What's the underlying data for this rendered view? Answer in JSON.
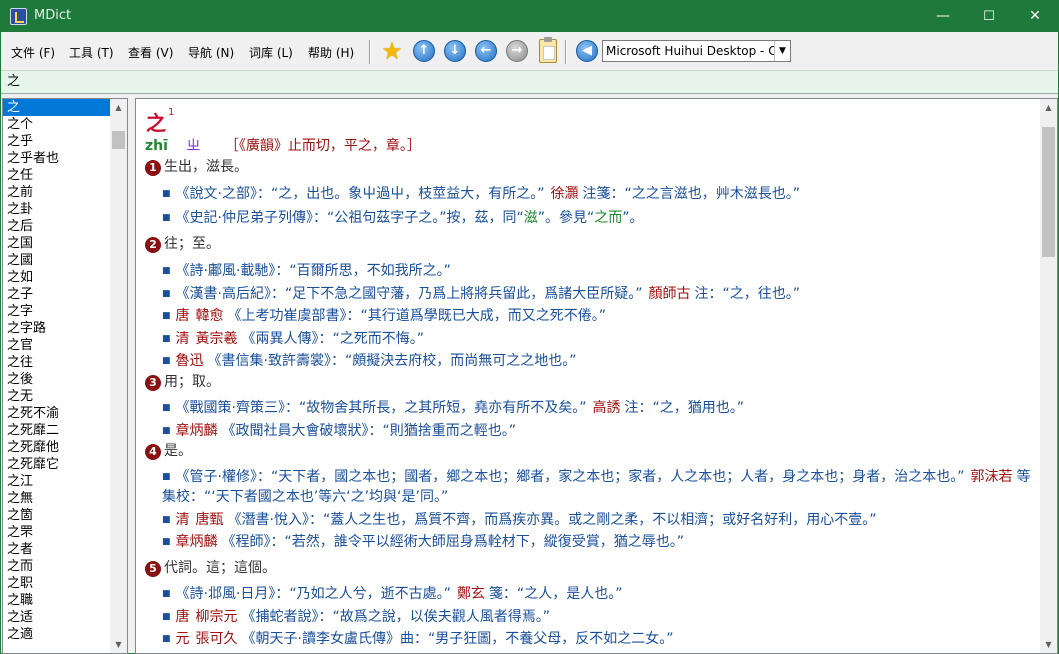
{
  "window": {
    "title": "MDict",
    "minimize": "—",
    "maximize": "☐",
    "close": "✕"
  },
  "menubar": {
    "file": "文件 (F)",
    "tools": "工具 (T)",
    "view": "查看 (V)",
    "nav": "导航 (N)",
    "lib": "词库 (L)",
    "help": "帮助 (H)"
  },
  "toolbar": {
    "dict_selected": "Microsoft Huihui Desktop - C",
    "icons": [
      "star-icon",
      "arrow-up-icon",
      "arrow-down-icon",
      "arrow-left-icon",
      "arrow-right-icon",
      "clipboard-icon",
      "speaker-back-icon"
    ]
  },
  "search": {
    "value": "之"
  },
  "wordlist": [
    "之",
    "之个",
    "之乎",
    "之乎者也",
    "之任",
    "之前",
    "之卦",
    "之后",
    "之国",
    "之國",
    "之如",
    "之子",
    "之字",
    "之字路",
    "之官",
    "之往",
    "之後",
    "之无",
    "之死不渝",
    "之死靡二",
    "之死靡他",
    "之死靡它",
    "之江",
    "之無",
    "之箇",
    "之罘",
    "之者",
    "之而",
    "之职",
    "之職",
    "之适",
    "之適"
  ],
  "entry": {
    "headword": "之",
    "sup": "1",
    "pinyin": "zhī",
    "zhuyin": "ㄓ",
    "fanqie": "［《廣韻》止而切，平之，章。］",
    "senses": [
      {
        "num": "1",
        "def": "生出，滋長。",
        "examples": [
          {
            "src": "《說文·之部》：",
            "q1": "“之，出也。象屮過屮，枝莖益大，有所之。”",
            "auth": "徐灝",
            "q2": "注箋：“之之言滋也，艸木滋長也。”"
          },
          {
            "src": "《史記·仲尼弟子列傳》：",
            "q1": "“公祖句茲字子之。”按，茲，同“",
            "g1": "滋",
            "q2": "”。參見“",
            "g2": "之而",
            "q3": "”。"
          }
        ]
      },
      {
        "num": "2",
        "def": "往；至。",
        "examples": [
          {
            "src": "《詩·鄘風·載馳》：",
            "q1": "“百爾所思，不如我所之。”"
          },
          {
            "src": "《漢書·高后紀》：",
            "q1": "“足下不急之國守藩，乃爲上將將兵留此，爲諸大臣所疑。”",
            "auth": "顏師古",
            "q2": "注：“之，往也。”"
          },
          {
            "era": "唐",
            "auth": "韓愈",
            "src": "《上考功崔虞部書》：",
            "q1": "“其行道爲學既已大成，而又之死不倦。”"
          },
          {
            "era": "清",
            "auth": "黃宗羲",
            "src": "《兩異人傳》：",
            "q1": "“之死而不悔。”"
          },
          {
            "auth": "魯迅",
            "src": "《書信集·致許壽裳》：",
            "q1": "“頗擬決去府校，而尚無可之之地也。”"
          }
        ]
      },
      {
        "num": "3",
        "def": "用；取。",
        "examples": [
          {
            "src": "《戰國策·齊策三》：",
            "q1": "“故物舍其所長，之其所短，堯亦有所不及矣。”",
            "auth": "高誘",
            "q2": "注：“之，猶用也。”"
          },
          {
            "auth": "章炳麟",
            "src": "《政聞社員大會破壞狀》：",
            "q1": "“則猶捨重而之輕也。”"
          }
        ]
      },
      {
        "num": "4",
        "def": "是。",
        "examples": [
          {
            "src": "《管子·權修》：",
            "q1": "“天下者，國之本也；國者，鄉之本也；鄉者，家之本也；家者，人之本也；人者，身之本也；身者，治之本也。”",
            "auth": "郭沫若",
            "q2": "等集校：“‘天下者國之本也’等六‘之’均與‘是’同。”"
          },
          {
            "era": "清",
            "auth": "唐甄",
            "src": "《潛書·悅入》：",
            "q1": "“蓋人之生也，爲質不齊，而爲疾亦異。或之剛之柔，不以相濟；或好名好利，用心不壹。”"
          },
          {
            "auth": "章炳麟",
            "src": "《程師》：",
            "q1": "“若然，誰令平以經術大師屈身爲輇材下，縱復受賞，猶之辱也。”"
          }
        ]
      },
      {
        "num": "5",
        "def": "代詞。這；這個。",
        "examples": [
          {
            "src": "《詩·邶風·日月》：",
            "q1": "“乃如之人兮，逝不古處。”",
            "auth": "鄭玄",
            "q2": "箋：“之人，是人也。”"
          },
          {
            "era": "唐",
            "auth": "柳宗元",
            "src": "《捕蛇者說》：",
            "q1": "“故爲之說，以俟夫觀人風者得焉。”"
          },
          {
            "era": "元",
            "auth": "張可久",
            "src": "《朝天子·讀李女盧氏傳》",
            "q1": "曲：“男子狂圖，不養父母，反不如之二女。”"
          }
        ]
      }
    ]
  }
}
